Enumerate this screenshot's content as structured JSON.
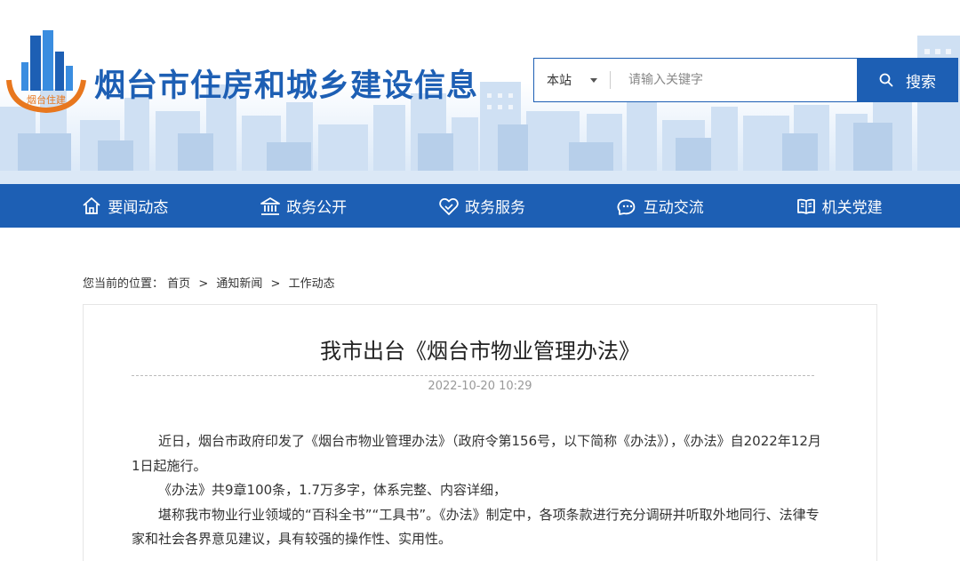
{
  "header": {
    "logo_text": "烟台住建",
    "site_title": "烟台市住房和城乡建设信息"
  },
  "search": {
    "scope_label": "本站",
    "placeholder": "请输入关键字",
    "button_label": "搜索"
  },
  "nav": {
    "items": [
      {
        "label": "要闻动态",
        "icon": "home-icon"
      },
      {
        "label": "政务公开",
        "icon": "government-building-icon"
      },
      {
        "label": "政务服务",
        "icon": "handshake-icon"
      },
      {
        "label": "互动交流",
        "icon": "chat-bubbles-icon"
      },
      {
        "label": "机关党建",
        "icon": "book-icon"
      }
    ]
  },
  "breadcrumb": {
    "prefix": "您当前的位置：",
    "items": [
      "首页",
      "通知新闻",
      "工作动态"
    ],
    "separator": ">"
  },
  "article": {
    "title": "我市出台《烟台市物业管理办法》",
    "date": "2022-10-20 10:29",
    "paragraphs": [
      "近日，烟台市政府印发了《烟台市物业管理办法》（政府令第156号，以下简称《办法》），《办法》自2022年12月1日起施行。",
      "《办法》共9章100条，1.7万多字，体系完整、内容详细，",
      "堪称我市物业行业领域的“百科全书”“工具书”。《办法》制定中，各项条款进行充分调研并听取外地同行、法律专家和社会各界意见建议，具有较强的操作性、实用性。"
    ]
  },
  "colors": {
    "brand_blue": "#1d5fb4",
    "logo_orange": "#e8771e"
  }
}
